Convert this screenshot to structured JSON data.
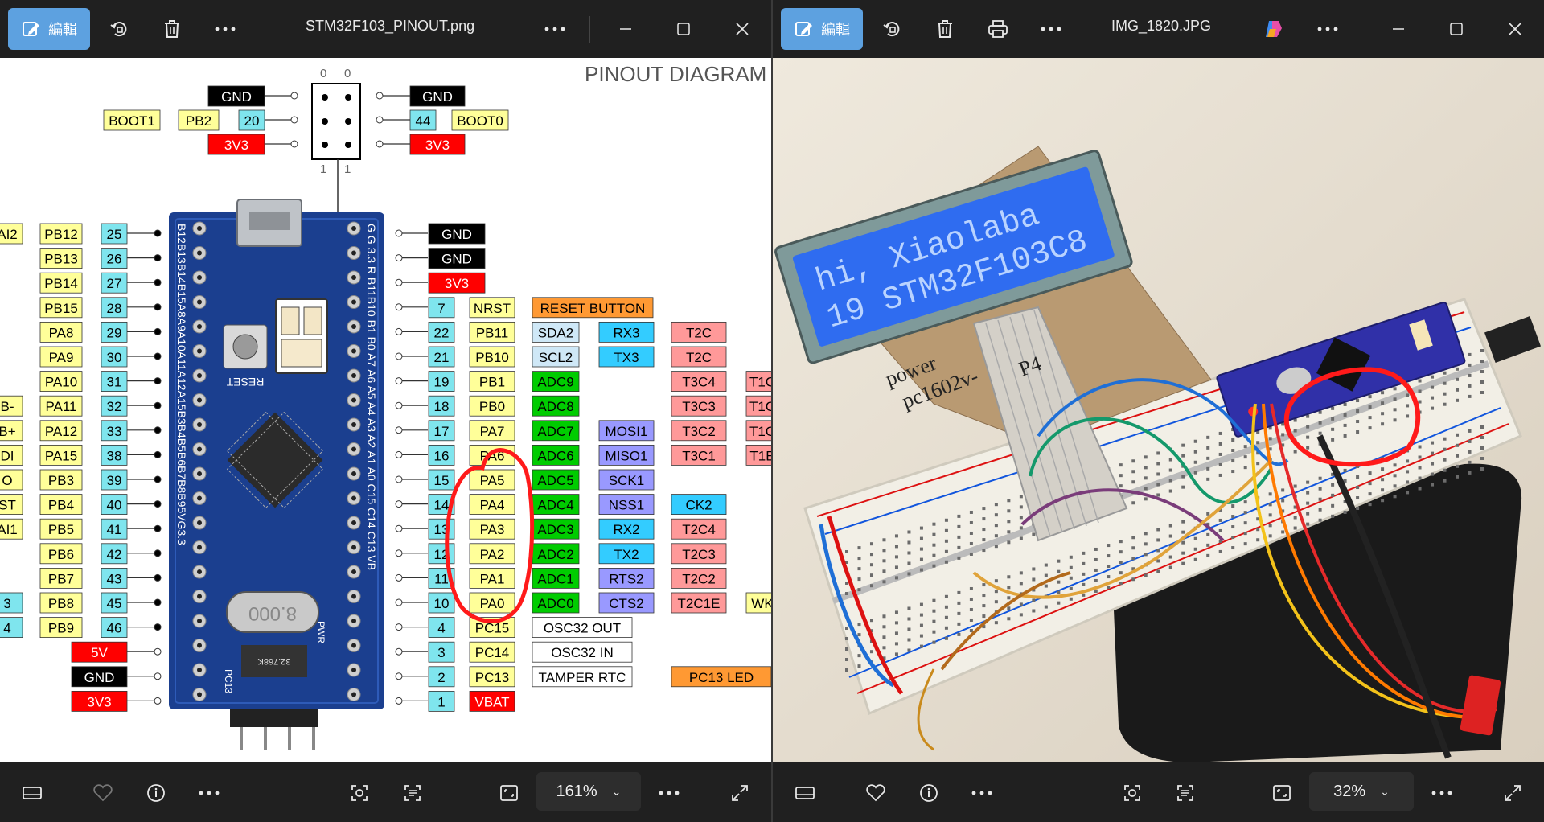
{
  "left_window": {
    "edit_label": "編輯",
    "title": "STM32F103_PINOUT.png",
    "zoom": "161%",
    "diagram": {
      "heading": "PINOUT DIAGRAM",
      "boot_header": {
        "top_numbers": [
          "0",
          "0"
        ],
        "bottom_numbers": [
          "1",
          "1"
        ],
        "left_rows": [
          {
            "labels": [
              "GND"
            ]
          },
          {
            "labels": [
              "BOOT1",
              "PB2",
              "20"
            ]
          },
          {
            "labels": [
              "3V3"
            ]
          }
        ],
        "right_rows": [
          {
            "labels": [
              "GND"
            ]
          },
          {
            "labels": [
              "44",
              "BOOT0"
            ]
          },
          {
            "labels": [
              "3V3"
            ]
          }
        ]
      },
      "left_pins": [
        {
          "func": "AI2",
          "pin": "PB12",
          "num": "25"
        },
        {
          "func": "",
          "pin": "PB13",
          "num": "26"
        },
        {
          "func": "",
          "pin": "PB14",
          "num": "27"
        },
        {
          "func": "",
          "pin": "PB15",
          "num": "28"
        },
        {
          "func": "",
          "pin": "PA8",
          "num": "29"
        },
        {
          "func": "",
          "pin": "PA9",
          "num": "30"
        },
        {
          "func": "",
          "pin": "PA10",
          "num": "31"
        },
        {
          "func": "B-",
          "pin": "PA11",
          "num": "32"
        },
        {
          "func": "B+",
          "pin": "PA12",
          "num": "33"
        },
        {
          "func": "DI",
          "pin": "PA15",
          "num": "38"
        },
        {
          "func": "O",
          "pin": "PB3",
          "num": "39"
        },
        {
          "func": "ST",
          "pin": "PB4",
          "num": "40"
        },
        {
          "func": "AI1",
          "pin": "PB5",
          "num": "41"
        },
        {
          "func": "",
          "pin": "PB6",
          "num": "42"
        },
        {
          "func": "",
          "pin": "PB7",
          "num": "43"
        },
        {
          "func": "3",
          "pin": "PB8",
          "num": "45"
        },
        {
          "func": "4",
          "pin": "PB9",
          "num": "46"
        },
        {
          "func": "",
          "pin": "5V",
          "num": ""
        },
        {
          "func": "",
          "pin": "GND",
          "num": ""
        },
        {
          "func": "",
          "pin": "3V3",
          "num": ""
        }
      ],
      "right_pins": [
        {
          "num": "",
          "pin": "GND",
          "f1": "",
          "f2": "",
          "f3": ""
        },
        {
          "num": "",
          "pin": "GND",
          "f1": "",
          "f2": "",
          "f3": ""
        },
        {
          "num": "",
          "pin": "3V3",
          "f1": "",
          "f2": "",
          "f3": ""
        },
        {
          "num": "7",
          "pin": "NRST",
          "f1": "RESET BUTTON",
          "f2": "",
          "f3": ""
        },
        {
          "num": "22",
          "pin": "PB11",
          "f1": "SDA2",
          "f2": "RX3",
          "f3": "T2C"
        },
        {
          "num": "21",
          "pin": "PB10",
          "f1": "SCL2",
          "f2": "TX3",
          "f3": "T2C"
        },
        {
          "num": "19",
          "pin": "PB1",
          "f1": "ADC9",
          "f2": "",
          "f3": "T3C4",
          "f4": "T1C"
        },
        {
          "num": "18",
          "pin": "PB0",
          "f1": "ADC8",
          "f2": "",
          "f3": "T3C3",
          "f4": "T1C"
        },
        {
          "num": "17",
          "pin": "PA7",
          "f1": "ADC7",
          "f2": "MOSI1",
          "f3": "T3C2",
          "f4": "T1C"
        },
        {
          "num": "16",
          "pin": "PA6",
          "f1": "ADC6",
          "f2": "MISO1",
          "f3": "T3C1",
          "f4": "T1E"
        },
        {
          "num": "15",
          "pin": "PA5",
          "f1": "ADC5",
          "f2": "SCK1",
          "f3": "",
          "f4": ""
        },
        {
          "num": "14",
          "pin": "PA4",
          "f1": "ADC4",
          "f2": "NSS1",
          "f3": "CK2",
          "f4": ""
        },
        {
          "num": "13",
          "pin": "PA3",
          "f1": "ADC3",
          "f2": "RX2",
          "f3": "T2C4",
          "f4": ""
        },
        {
          "num": "12",
          "pin": "PA2",
          "f1": "ADC2",
          "f2": "TX2",
          "f3": "T2C3",
          "f4": ""
        },
        {
          "num": "11",
          "pin": "PA1",
          "f1": "ADC1",
          "f2": "RTS2",
          "f3": "T2C2",
          "f4": ""
        },
        {
          "num": "10",
          "pin": "PA0",
          "f1": "ADC0",
          "f2": "CTS2",
          "f3": "T2C1E",
          "f4": "WK"
        },
        {
          "num": "4",
          "pin": "PC15",
          "f1": "OSC32 OUT",
          "f2": "",
          "f3": ""
        },
        {
          "num": "3",
          "pin": "PC14",
          "f1": "OSC32 IN",
          "f2": "",
          "f3": ""
        },
        {
          "num": "2",
          "pin": "PC13",
          "f1": "TAMPER RTC",
          "f2": "PC13 LED",
          "f3": ""
        },
        {
          "num": "1",
          "pin": "VBAT",
          "f1": "",
          "f2": "",
          "f3": ""
        }
      ],
      "board_labels": {
        "reset": "RESET",
        "crystal": "8.000",
        "rtc_crystal": "32.768K",
        "left_col": "B12B13B14B15A8A9A10A11A12A15B3B4B5B6B7B8B95VG3.3",
        "right_col": "G G 3.3 R B11B10 B1 B0 A7 A6 A5 A4 A3 A2 A1 A0 C15 C14 C13 VB",
        "pc13": "PC13",
        "pwr": "PWR"
      }
    }
  },
  "right_window": {
    "edit_label": "編輯",
    "title": "IMG_1820.JPG",
    "zoom": "32%",
    "photo_text": {
      "lcd_line1": "hi, Xiaolaba",
      "lcd_line2": "19 STM32F103C8",
      "card_line1": "power",
      "card_line2": "pc1602v-",
      "card_line3": "P4"
    }
  },
  "colors": {
    "accent": "#5da1e0",
    "circle": "#ff1a1a",
    "pin_yellow": "#ffff99",
    "pin_cyan": "#7fe5ee",
    "gnd_black": "#000000",
    "v33_red": "#ff0000",
    "adc_green": "#00cc00",
    "spi_purple": "#9999ff",
    "uart_cyan": "#33ccff",
    "timer_pink": "#ff9999",
    "reset_orange": "#ff9933",
    "board_blue": "#1a3a8a"
  },
  "icons": [
    "edit-icon",
    "rotate-icon",
    "delete-icon",
    "more-icon",
    "minimize-icon",
    "maximize-icon",
    "close-icon",
    "print-icon",
    "copilot-icon",
    "filmstrip-icon",
    "favorite-icon",
    "info-icon",
    "visual-search-icon",
    "text-scan-icon",
    "fit-icon",
    "fullscreen-icon"
  ]
}
